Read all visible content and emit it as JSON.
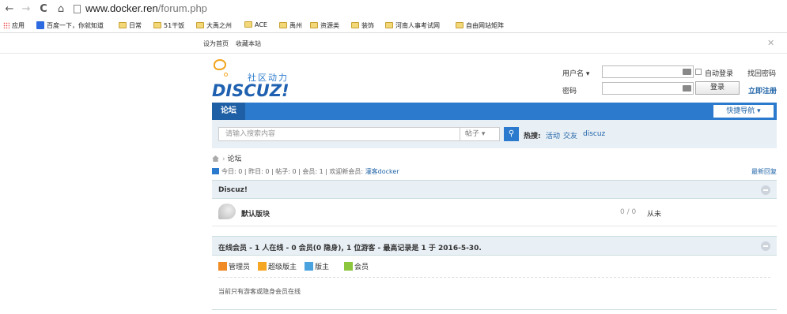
{
  "browser": {
    "back_icon": "←",
    "forward_icon": "→",
    "reload_icon": "C",
    "home_icon": "⌂",
    "url_host": "www.docker.ren",
    "url_path": "/forum.php"
  },
  "bookmarks": [
    "应用",
    "百度一下，你就知道",
    "日常",
    "51干饭",
    "大禹之州",
    "ACE",
    "禹州",
    "资源类",
    "装饰",
    "河南人事考试网",
    "自由网站矩阵"
  ],
  "topbar": {
    "set_home": "设为首页",
    "bookmark_site": "收藏本站",
    "close": "✕"
  },
  "logo": {
    "cn": "社区动力",
    "main": "DISCUZ!"
  },
  "login": {
    "username_label": "用户名 ▾",
    "password_label": "密码",
    "auto_login": "自动登录",
    "find_password": "找回密码",
    "login_button": "登录",
    "register": "立即注册"
  },
  "nav": {
    "forum_tab": "论坛",
    "quick_nav": "快捷导航 ▾"
  },
  "search": {
    "placeholder": "请输入搜索内容",
    "type": "帖子 ▾",
    "hot_label": "热搜:",
    "hot_links": [
      "活动",
      "交友",
      "discuz"
    ]
  },
  "breadcrumb": {
    "current": "论坛"
  },
  "stats": {
    "today": "今日: 0",
    "yesterday": "昨日: 0",
    "posts": "帖子: 0",
    "members": "会员: 1",
    "welcome": "欢迎新会员:",
    "new_member": "灌客docker",
    "latest_reply": "最新回复"
  },
  "category": {
    "title": "Discuz!"
  },
  "forum": {
    "name": "默认版块",
    "count": "0 / 0",
    "last_post": "从未"
  },
  "online": {
    "title": "在线会员 - 1 人在线 - 0 会员(0 隐身), 1 位游客 - 最高记录是 1 于 2016-5-30.",
    "legend": [
      {
        "label": "管理员",
        "color": "#f08a24"
      },
      {
        "label": "超级版主",
        "color": "#f5a623"
      },
      {
        "label": "版主",
        "color": "#4aa3df"
      },
      {
        "label": "会员",
        "color": "#8cc63f"
      }
    ],
    "note": "当前只有游客或隐身会员在线"
  },
  "colors": {
    "accent": "#2b7acd",
    "link": "#2366a8",
    "box_bg": "#e8eff5"
  }
}
